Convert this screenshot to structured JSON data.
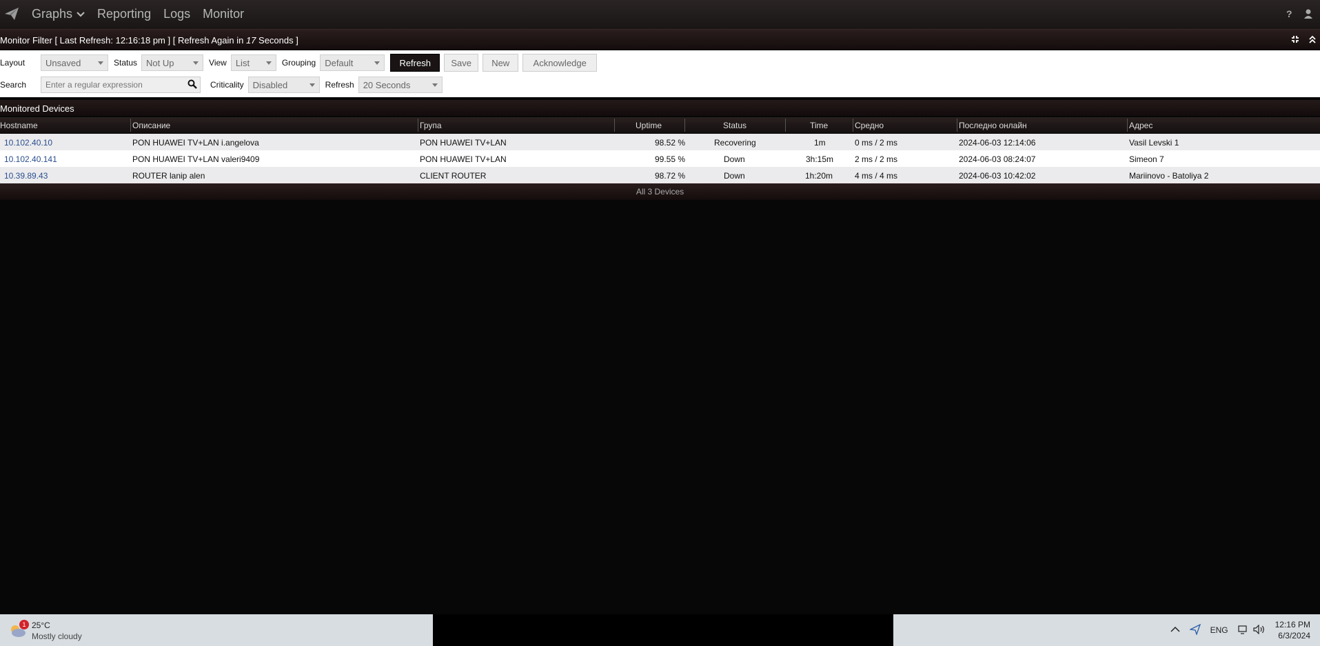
{
  "nav": {
    "items": [
      {
        "label": "Graphs",
        "has_dropdown": true
      },
      {
        "label": "Reporting"
      },
      {
        "label": "Logs"
      },
      {
        "label": "Monitor"
      }
    ],
    "help_icon": "question-icon",
    "user_icon": "user-icon"
  },
  "titlebar": {
    "prefix": "Monitor Filter [ Last Refresh: 12:16:18 pm ] [ Refresh Again in ",
    "countdown": "17",
    "suffix": " Seconds ]"
  },
  "filters": {
    "layout_label": "Layout",
    "layout_value": "Unsaved",
    "status_label": "Status",
    "status_value": "Not Up",
    "view_label": "View",
    "view_value": "List",
    "grouping_label": "Grouping",
    "grouping_value": "Default",
    "refresh_btn": "Refresh",
    "save_btn": "Save",
    "new_btn": "New",
    "ack_btn": "Acknowledge",
    "search_label": "Search",
    "search_placeholder": "Enter a regular expression",
    "criticality_label": "Criticality",
    "criticality_value": "Disabled",
    "refresh_label": "Refresh",
    "refresh_value": "20 Seconds"
  },
  "section": {
    "title": "Monitored Devices"
  },
  "table": {
    "columns": {
      "hostname": "Hostname",
      "description": "Описание",
      "group": "Група",
      "uptime": "Uptime",
      "status": "Status",
      "time": "Time",
      "avg": "Средно",
      "last_online": "Последно онлайн",
      "address": "Адрес"
    },
    "rows": [
      {
        "hostname": "10.102.40.10",
        "description": "PON HUAWEI TV+LAN i.angelova",
        "group": "PON HUAWEI TV+LAN",
        "uptime": "98.52 %",
        "status": "Recovering",
        "time": "1m",
        "avg": "0 ms / 2 ms",
        "last_online": "2024-06-03 12:14:06",
        "address": "Vasil Levski 1"
      },
      {
        "hostname": "10.102.40.141",
        "description": "PON HUAWEI TV+LAN valeri9409",
        "group": "PON HUAWEI TV+LAN",
        "uptime": "99.55 %",
        "status": "Down",
        "time": "3h:15m",
        "avg": "2 ms / 2 ms",
        "last_online": "2024-06-03 08:24:07",
        "address": "Simeon 7"
      },
      {
        "hostname": "10.39.89.43",
        "description": "ROUTER lanip alen",
        "group": "CLIENT ROUTER",
        "uptime": "98.72 %",
        "status": "Down",
        "time": "1h:20m",
        "avg": "4 ms / 4 ms",
        "last_online": "2024-06-03 10:42:02",
        "address": "Mariinovo - Batoliya 2"
      }
    ],
    "footer": "All 3 Devices"
  },
  "taskbar": {
    "weather_temp": "25°C",
    "weather_desc": "Mostly cloudy",
    "weather_badge": "1",
    "lang": "ENG",
    "time": "12:16 PM",
    "date": "6/3/2024"
  }
}
